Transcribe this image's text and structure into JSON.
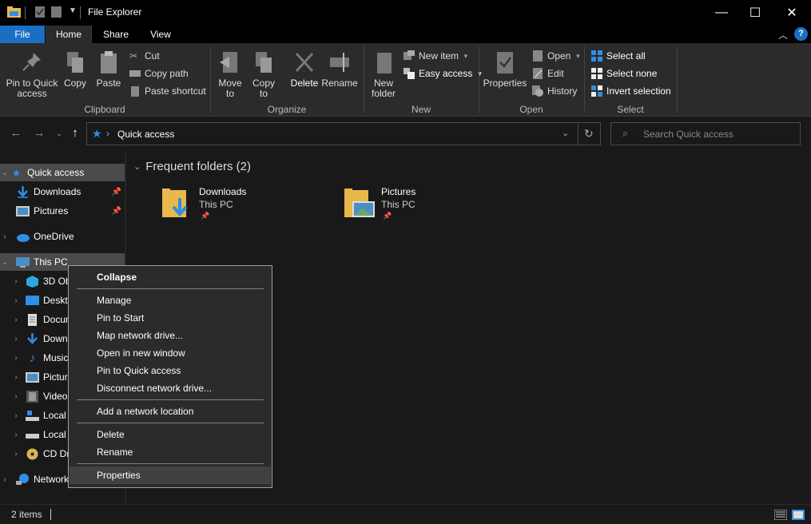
{
  "window": {
    "title": "File Explorer",
    "minimize_glyph": "—",
    "maximize_glyph": "☐",
    "close_glyph": "✕"
  },
  "ribbon_tabs": [
    {
      "label": "File"
    },
    {
      "label": "Home"
    },
    {
      "label": "Share"
    },
    {
      "label": "View"
    }
  ],
  "ribbon": {
    "clipboard": {
      "label": "Clipboard",
      "pin": "Pin to Quick access",
      "copy": "Copy",
      "paste": "Paste",
      "cut": "Cut",
      "copy_path": "Copy path",
      "paste_shortcut": "Paste shortcut"
    },
    "organize": {
      "label": "Organize",
      "move_to": "Move to",
      "copy_to": "Copy to",
      "delete": "Delete",
      "rename": "Rename"
    },
    "new": {
      "label": "New",
      "new_folder": "New folder",
      "new_item": "New item",
      "easy_access": "Easy access"
    },
    "open": {
      "label": "Open",
      "properties": "Properties",
      "open": "Open",
      "edit": "Edit",
      "history": "History"
    },
    "select": {
      "label": "Select",
      "select_all": "Select all",
      "select_none": "Select none",
      "invert_selection": "Invert selection"
    }
  },
  "address": {
    "path": "Quick access",
    "search_placeholder": "Search Quick access"
  },
  "nav_pane": [
    {
      "label": "Quick access"
    },
    {
      "label": "Downloads"
    },
    {
      "label": "Pictures"
    },
    {
      "label": "OneDrive"
    },
    {
      "label": "This PC"
    },
    {
      "label": "3D Objects"
    },
    {
      "label": "Desktop"
    },
    {
      "label": "Documents"
    },
    {
      "label": "Downloads"
    },
    {
      "label": "Music"
    },
    {
      "label": "Pictures"
    },
    {
      "label": "Videos"
    },
    {
      "label": "Local Disk (C:)"
    },
    {
      "label": "Local Disk (D:)"
    },
    {
      "label": "CD Drive (E:)"
    },
    {
      "label": "Network"
    }
  ],
  "content": {
    "section_title": "Frequent folders (2)",
    "folders": [
      {
        "name": "Downloads",
        "location": "This PC"
      },
      {
        "name": "Pictures",
        "location": "This PC"
      }
    ]
  },
  "context_menu": [
    {
      "label": "Collapse"
    },
    {
      "label": "Manage"
    },
    {
      "label": "Pin to Start"
    },
    {
      "label": "Map network drive..."
    },
    {
      "label": "Open in new window"
    },
    {
      "label": "Pin to Quick access"
    },
    {
      "label": "Disconnect network drive..."
    },
    {
      "label": "Add a network location"
    },
    {
      "label": "Delete"
    },
    {
      "label": "Rename"
    },
    {
      "label": "Properties"
    }
  ],
  "status": {
    "item_count": "2 items"
  },
  "colors": {
    "accent": "#1a6fc4",
    "folder_yellow": "#e8b94a",
    "download_blue": "#2f8ee8"
  }
}
